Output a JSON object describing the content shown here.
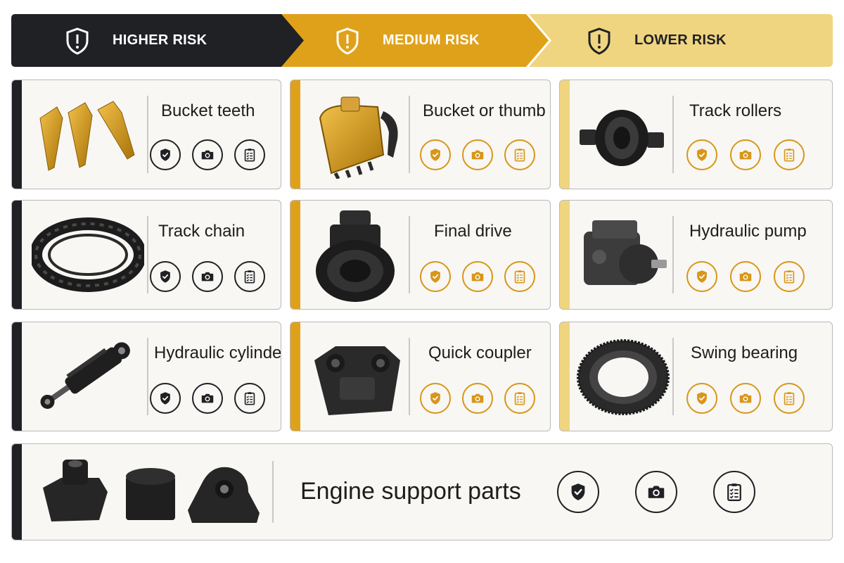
{
  "colors": {
    "high": "#1f2124",
    "medium": "#e0a11a",
    "low": "#f0d580",
    "high_icon": "#1f2124",
    "medium_icon": "#d8961a",
    "low_icon": "#d8961a"
  },
  "header": {
    "high": {
      "label": "HIGHER RISK",
      "icon": "shield-alert-icon"
    },
    "medium": {
      "label": "MEDIUM RISK",
      "icon": "shield-alert-icon"
    },
    "low": {
      "label": "LOWER RISK",
      "icon": "shield-alert-icon"
    }
  },
  "action_icons": [
    "shield-check-icon",
    "camera-icon",
    "checklist-icon"
  ],
  "parts": {
    "bucket_teeth": {
      "name": "Bucket teeth",
      "risk": "high",
      "image": "bucket-teeth-image"
    },
    "track_chain": {
      "name": "Track chain",
      "risk": "high",
      "image": "track-chain-image"
    },
    "hydraulic_cylinder": {
      "name": "Hydraulic cylinder",
      "risk": "high",
      "image": "hydraulic-cylinder-image"
    },
    "bucket_thumb": {
      "name": "Bucket or thumb",
      "risk": "medium",
      "image": "bucket-thumb-image"
    },
    "final_drive": {
      "name": "Final drive",
      "risk": "medium",
      "image": "final-drive-image"
    },
    "quick_coupler": {
      "name": "Quick coupler",
      "risk": "medium",
      "image": "quick-coupler-image"
    },
    "track_rollers": {
      "name": "Track rollers",
      "risk": "low",
      "image": "track-rollers-image"
    },
    "hydraulic_pump": {
      "name": "Hydraulic pump",
      "risk": "low",
      "image": "hydraulic-pump-image"
    },
    "swing_bearing": {
      "name": "Swing bearing",
      "risk": "low",
      "image": "swing-bearing-image"
    },
    "engine_support": {
      "name": "Engine support parts",
      "risk": "high",
      "image": "engine-support-parts-image"
    }
  }
}
